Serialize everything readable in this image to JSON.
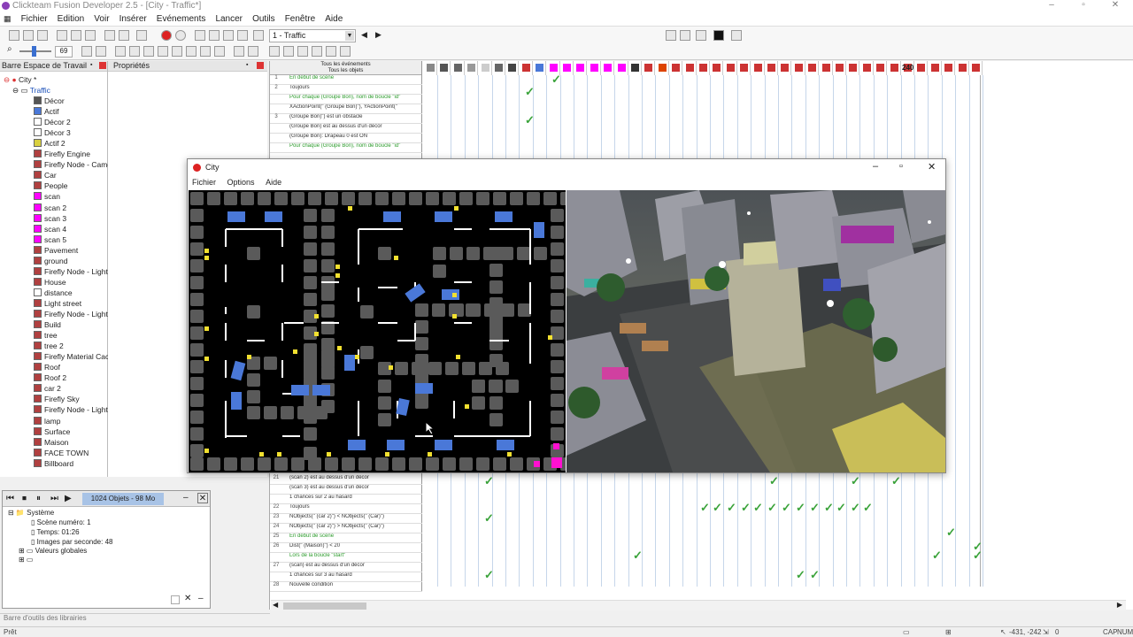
{
  "app": {
    "title": "Clickteam Fusion Developer 2.5 - [City - Traffic*]",
    "controls": {
      "minimize": "–",
      "maximize": "▫",
      "close": "✕"
    }
  },
  "menu": [
    "Fichier",
    "Edition",
    "Voir",
    "Insérer",
    "Evénements",
    "Lancer",
    "Outils",
    "Fenêtre",
    "Aide"
  ],
  "toolbar": {
    "frame_selector": "1 - Traffic",
    "zoom_value": "69"
  },
  "workspace": {
    "title": "Barre Espace de Travail",
    "app_node": "City *",
    "frame_node": "Traffic",
    "objects": [
      {
        "label": "Décor",
        "color": "#555555"
      },
      {
        "label": "Actif",
        "color": "#4a78d8"
      },
      {
        "label": "Décor 2",
        "color": "#ffffff"
      },
      {
        "label": "Décor 3",
        "color": "#ffffff"
      },
      {
        "label": "Actif 2",
        "color": "#d8d040"
      },
      {
        "label": "Firefly Engine",
        "color": "#b04040"
      },
      {
        "label": "Firefly Node - Came",
        "color": "#b04040"
      },
      {
        "label": "Car",
        "color": "#b04040"
      },
      {
        "label": "People",
        "color": "#b04040"
      },
      {
        "label": "scan",
        "color": "#ff00ff"
      },
      {
        "label": "scan 2",
        "color": "#ff00ff"
      },
      {
        "label": "scan 3",
        "color": "#ff00ff"
      },
      {
        "label": "scan 4",
        "color": "#ff00ff"
      },
      {
        "label": "scan 5",
        "color": "#ff00ff"
      },
      {
        "label": "Pavement",
        "color": "#b04040"
      },
      {
        "label": "ground",
        "color": "#b04040"
      },
      {
        "label": "Firefly Node - Light",
        "color": "#b04040"
      },
      {
        "label": "House",
        "color": "#b04040"
      },
      {
        "label": "distance",
        "color": "#ffffff",
        "badge": "240"
      },
      {
        "label": "Light street",
        "color": "#b04040"
      },
      {
        "label": "Firefly Node - Light",
        "color": "#b04040"
      },
      {
        "label": "Build",
        "color": "#b04040"
      },
      {
        "label": "tree",
        "color": "#b04040"
      },
      {
        "label": "tree 2",
        "color": "#b04040"
      },
      {
        "label": "Firefly Material Cach",
        "color": "#b04040"
      },
      {
        "label": "Roof",
        "color": "#b04040"
      },
      {
        "label": "Roof 2",
        "color": "#b04040"
      },
      {
        "label": "car 2",
        "color": "#b04040"
      },
      {
        "label": "Firefly Sky",
        "color": "#b04040"
      },
      {
        "label": "Firefly Node - Light",
        "color": "#b04040"
      },
      {
        "label": "lamp",
        "color": "#b04040"
      },
      {
        "label": "Surface",
        "color": "#b04040"
      },
      {
        "label": "Maison",
        "color": "#b04040"
      },
      {
        "label": "FACE TOWN",
        "color": "#b04040"
      },
      {
        "label": "Billboard",
        "color": "#b04040"
      }
    ]
  },
  "properties": {
    "title": "Propriétés"
  },
  "events": {
    "header_line1": "Tous les événements",
    "header_line2": "Tous les objets",
    "counter_badge": "240",
    "rows_top": [
      {
        "num": "1",
        "text": "En début de scène",
        "green": true
      },
      {
        "num": "2",
        "text": "Toujours",
        "green": false
      },
      {
        "num": "",
        "text": "Pour chaque   (Groupe Bon), nom de boucle \"id\"",
        "green": true
      },
      {
        "num": "",
        "text": "XActionPoint(\"  (Groupe Bon)\"), YActionPoint(\"",
        "green": false
      },
      {
        "num": "3",
        "text": "(Groupe Bon)\") est un obstacle",
        "green": false
      },
      {
        "num": "",
        "text": "(Groupe Bon) est au dessus d'un décor",
        "green": false
      },
      {
        "num": "",
        "text": "(Groupe Bon): Drapeau 0 est ON",
        "green": false
      },
      {
        "num": "",
        "text": "Pour chaque   (Groupe Bon), nom de boucle \"id\"",
        "green": true
      }
    ],
    "rows_bottom": [
      {
        "num": "21",
        "text": "(scan 2) est au dessus d'un décor",
        "green": false
      },
      {
        "num": "",
        "text": "(scan 3) est au dessus d'un décor",
        "green": false
      },
      {
        "num": "",
        "text": "1 chances sur 2 au hasard",
        "green": false
      },
      {
        "num": "22",
        "text": "Toujours",
        "green": false
      },
      {
        "num": "23",
        "text": "NObjects(\"  (car 2)\") < NObjects(\"  (Car)\")",
        "green": false
      },
      {
        "num": "24",
        "text": "NObjects(\"  (car 2)\") > NObjects(\"  (Car)\")",
        "green": false
      },
      {
        "num": "25",
        "text": "En début de scène",
        "green": true
      },
      {
        "num": "26",
        "text": "Dist(\"  (Maison)\") < 20",
        "green": false
      },
      {
        "num": "",
        "text": "Lors de la boucle \"start\"",
        "green": true
      },
      {
        "num": "27",
        "text": "(scan) est au dessus d'un décor",
        "green": false
      },
      {
        "num": "",
        "text": "1 chances sur 3 au hasard",
        "green": false
      },
      {
        "num": "28",
        "text": "Nouvelle condition",
        "green": false
      }
    ]
  },
  "city_window": {
    "title": "City",
    "menu": [
      "Fichier",
      "Options",
      "Aide"
    ]
  },
  "debugger": {
    "info": "1024 Objets - 98 Mo",
    "system": "Système",
    "scene": "Scène numéro: 1",
    "time": "Temps: 01:26",
    "fps": "Images par seconde: 48",
    "globals": "Valeurs globales"
  },
  "library_bar": "Barre d'outils des librairies",
  "status": {
    "left": "Prêt",
    "coords": "-431, -242",
    "count": "0",
    "caps": "CAP",
    "num": "NUM"
  }
}
